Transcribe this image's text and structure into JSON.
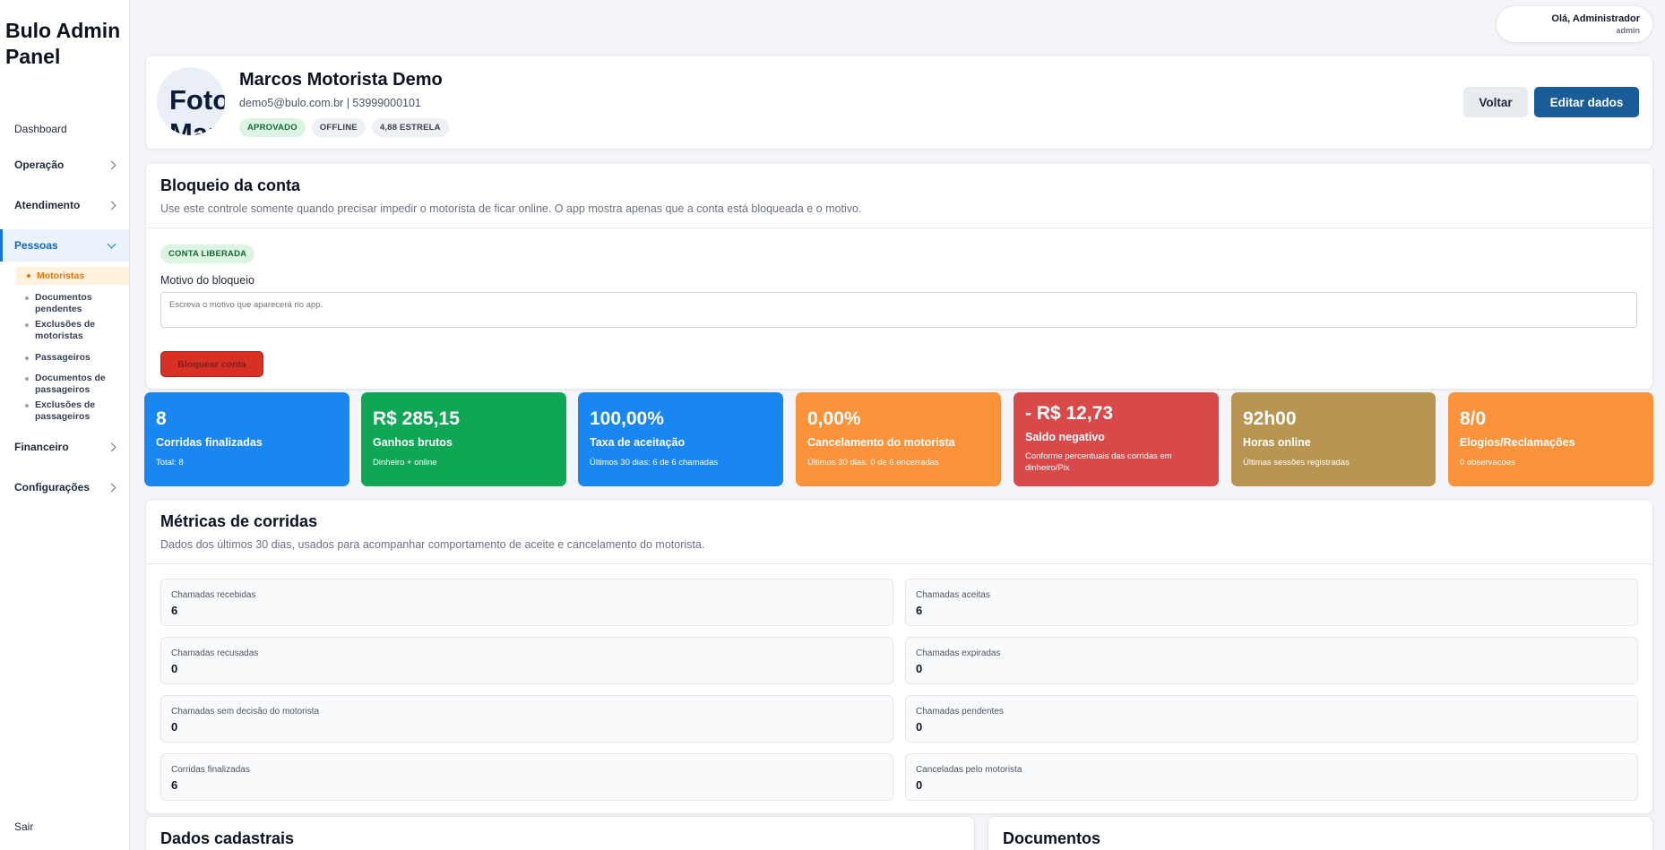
{
  "sidebar": {
    "brand": "Bulo Admin Panel",
    "dashboard": "Dashboard",
    "groups": {
      "operacao": "Operação",
      "atendimento": "Atendimento",
      "pessoas": "Pessoas",
      "financeiro": "Financeiro",
      "configuracoes": "Configurações"
    },
    "pessoas_items": [
      "Motoristas",
      "Documentos pendentes",
      "Exclusões de motoristas",
      "Passageiros",
      "Documentos de passageiros",
      "Exclusões de passageiros"
    ],
    "logout": "Sair"
  },
  "user": {
    "greeting": "Olá, Administrador",
    "role": "admin"
  },
  "profile": {
    "avatar_text": "Foto Marcos",
    "name": "Marcos Motorista Demo",
    "contact": "demo5@bulo.com.br | 53999000101",
    "badges": [
      "APROVADO",
      "OFFLINE",
      "4,88 ESTRELA"
    ],
    "back_label": "Voltar",
    "edit_label": "Editar dados"
  },
  "block": {
    "title": "Bloqueio da conta",
    "subtitle": "Use este controle somente quando precisar impedir o motorista de ficar online. O app mostra apenas que a conta está bloqueada e o motivo.",
    "status_badge": "CONTA LIBERADA",
    "reason_label": "Motivo do bloqueio",
    "reason_placeholder": "Escreva o motivo que aparecerá no app.",
    "block_button": "Bloquear conta"
  },
  "stats": [
    {
      "value": "8",
      "title": "Corridas finalizadas",
      "sub": "Total: 8",
      "color": "#1a86f0"
    },
    {
      "value": "R$ 285,15",
      "title": "Ganhos brutos",
      "sub": "Dinheiro + online",
      "color": "#0fa656"
    },
    {
      "value": "100,00%",
      "title": "Taxa de aceitação",
      "sub": "Últimos 30 dias: 6 de 6 chamadas",
      "color": "#1a86f0"
    },
    {
      "value": "0,00%",
      "title": "Cancelamento do motorista",
      "sub": "Últimos 30 dias: 0 de 6 encerradas",
      "color": "#fb923c"
    },
    {
      "value": "- R$ 12,73",
      "title": "Saldo negativo",
      "sub": "Conforme percentuais das corridas em dinheiro/Pix",
      "color": "#d84a4a"
    },
    {
      "value": "92h00",
      "title": "Horas online",
      "sub": "Últimas sessões registradas",
      "color": "#b89550"
    },
    {
      "value": "8/0",
      "title": "Elogios/Reclamações",
      "sub": "0 observacoes",
      "color": "#fb923c"
    }
  ],
  "metrics": {
    "title": "Métricas de corridas",
    "subtitle": "Dados dos últimos 30 dias, usados para acompanhar comportamento de aceite e cancelamento do motorista.",
    "items": [
      {
        "label": "Chamadas recebidas",
        "value": "6"
      },
      {
        "label": "Chamadas aceitas",
        "value": "6"
      },
      {
        "label": "Chamadas recusadas",
        "value": "0"
      },
      {
        "label": "Chamadas expiradas",
        "value": "0"
      },
      {
        "label": "Chamadas sem decisão do motorista",
        "value": "0"
      },
      {
        "label": "Chamadas pendentes",
        "value": "0"
      },
      {
        "label": "Corridas finalizadas",
        "value": "6"
      },
      {
        "label": "Canceladas pelo motorista",
        "value": "0"
      }
    ]
  },
  "sections": {
    "cadastro": "Dados cadastrais",
    "documentos": "Documentos"
  }
}
